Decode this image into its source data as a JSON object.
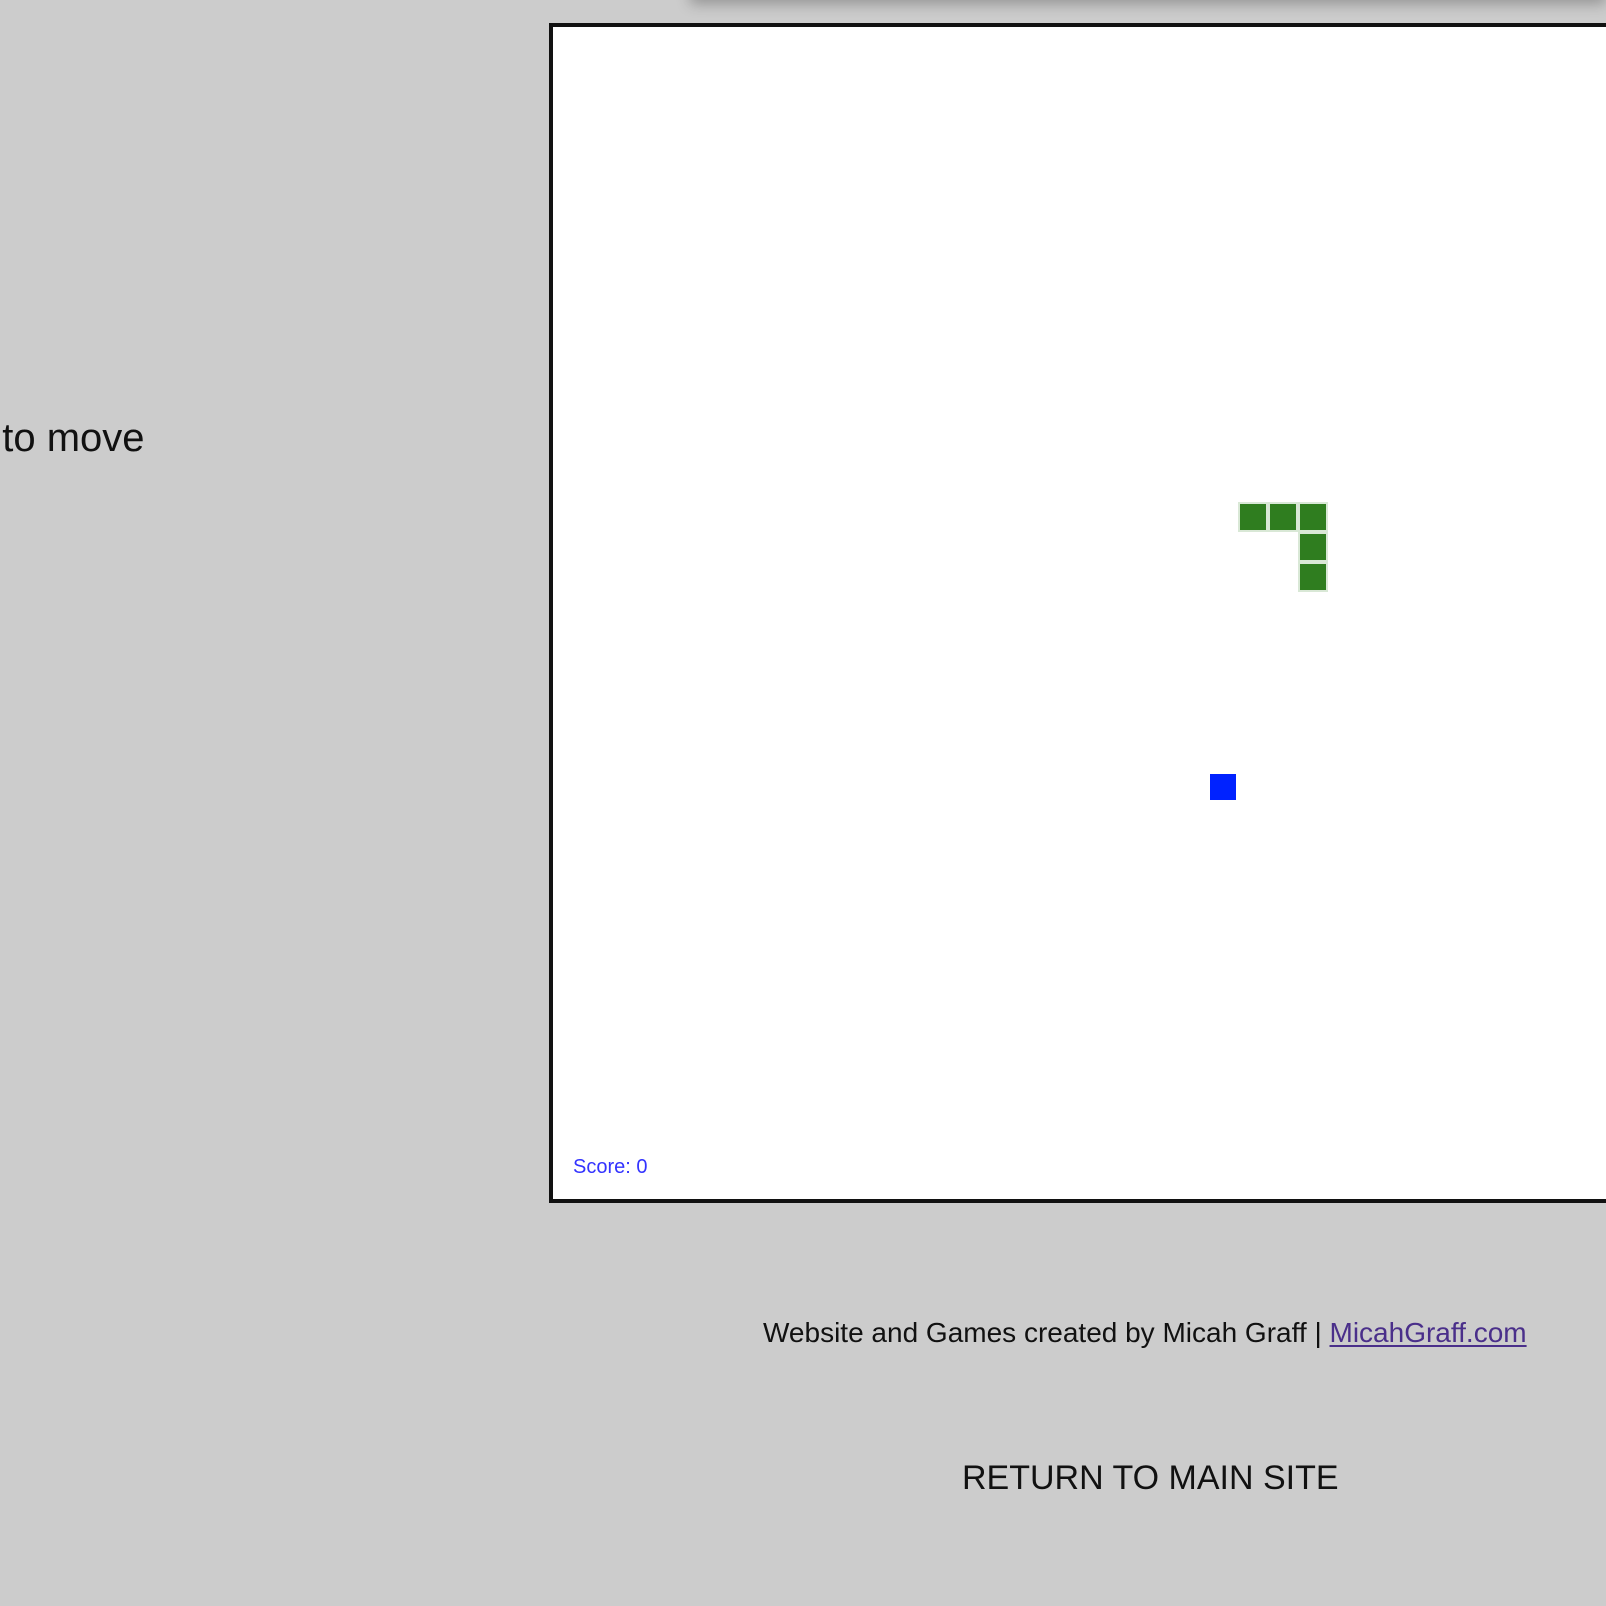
{
  "instructions": {
    "text": ". to move"
  },
  "game": {
    "score_label": "Score:",
    "score_value": "0",
    "grid": {
      "columns": 37,
      "rows": 40
    },
    "snake": {
      "color": "#2f7d1f",
      "segments": [
        {
          "col": 23,
          "row": 16
        },
        {
          "col": 24,
          "row": 16
        },
        {
          "col": 25,
          "row": 16
        },
        {
          "col": 25,
          "row": 17
        },
        {
          "col": 25,
          "row": 18
        }
      ]
    },
    "food": {
      "color": "#0022ff",
      "col": 22,
      "row": 25
    },
    "score_color": "#3333ff"
  },
  "footer": {
    "credit_text": "Website and Games created by Micah Graff |",
    "credit_link": "MicahGraff.com",
    "return_link": "RETURN TO MAIN SITE",
    "link_color": "#4a2f8a"
  }
}
